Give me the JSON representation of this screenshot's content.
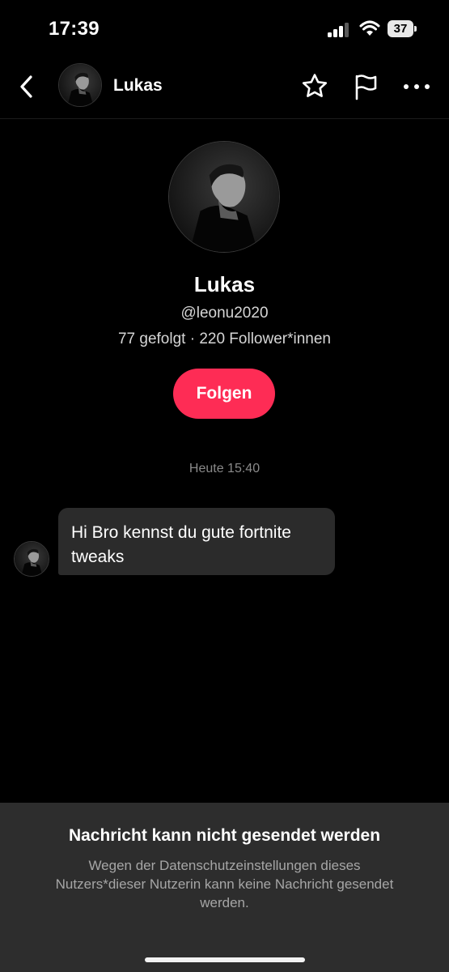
{
  "status_bar": {
    "time": "17:39",
    "battery_level": "37"
  },
  "header": {
    "name": "Lukas",
    "icons": [
      "back-chevron-icon",
      "star-icon",
      "flag-icon",
      "more-dots-icon"
    ]
  },
  "profile": {
    "name": "Lukas",
    "handle": "@leonu2020",
    "stats": "77 gefolgt · 220 Follower*innen",
    "follow_label": "Folgen"
  },
  "conversation": {
    "timestamp": "Heute 15:40",
    "messages": [
      {
        "text": "Hi Bro kennst du gute fortnite tweaks"
      }
    ]
  },
  "notice": {
    "title": "Nachricht kann nicht gesendet werden",
    "body": "Wegen der Datenschutzeinstellungen dieses Nutzers*dieser Nutzerin kann keine Nachricht gesendet werden."
  },
  "colors": {
    "accent": "#fe2c55",
    "background": "#000000",
    "bubble": "#2b2b2b",
    "panel": "#2d2d2d"
  }
}
